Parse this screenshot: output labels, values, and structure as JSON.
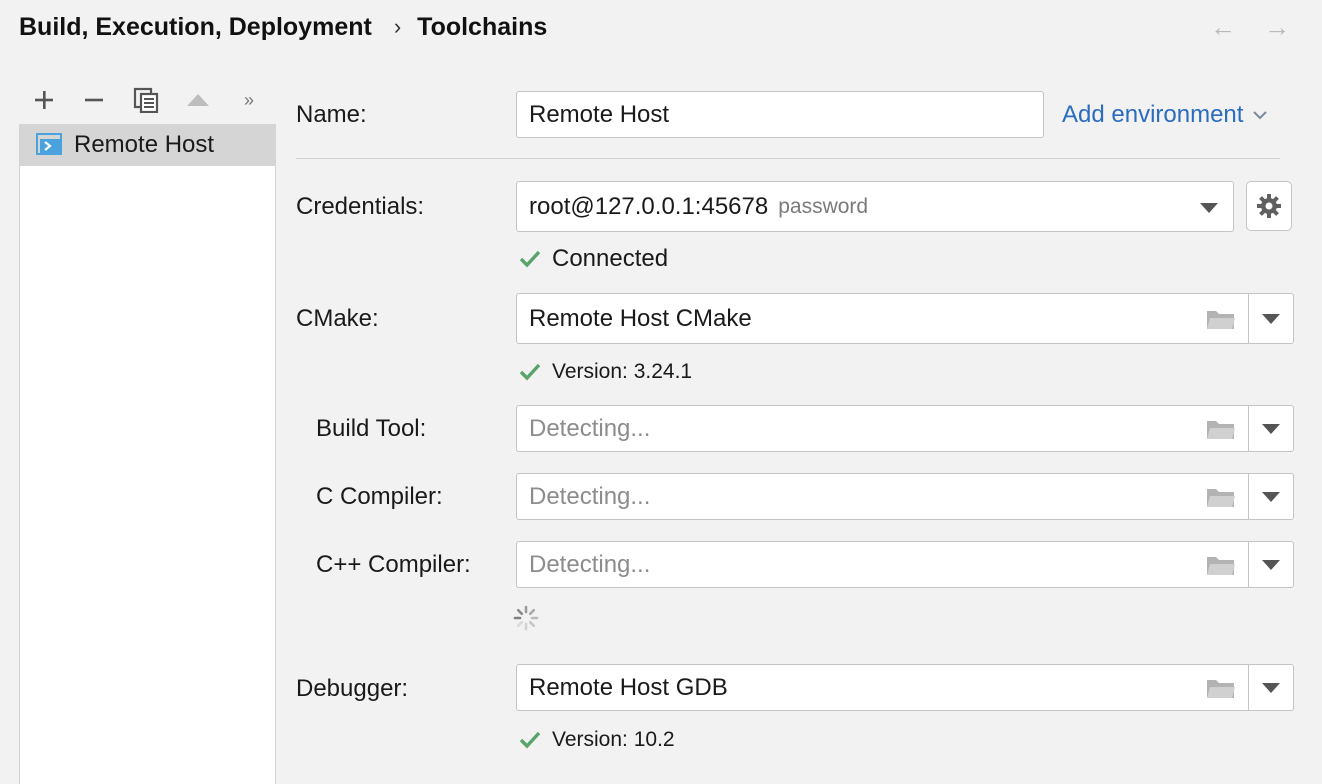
{
  "header": {
    "breadcrumb_parent": "Build, Execution, Deployment",
    "breadcrumb_separator": "›",
    "breadcrumb_current": "Toolchains",
    "back_arrow": "←",
    "forward_arrow": "→"
  },
  "toolbar": {
    "add_icon": "plus-icon",
    "remove_icon": "minus-icon",
    "copy_icon": "copy-icon",
    "move_up_icon": "triangle-up-icon",
    "more_label": "»"
  },
  "toolchains": {
    "items": [
      {
        "label": "Remote Host",
        "icon": "remote-host-icon",
        "selected": true
      }
    ]
  },
  "form": {
    "name_label": "Name:",
    "name_value": "Remote Host",
    "add_environment_label": "Add environment",
    "credentials_label": "Credentials:",
    "credentials_value": "root@127.0.0.1:45678",
    "credentials_hint": "password",
    "credentials_status": "Connected",
    "cmake_label": "CMake:",
    "cmake_value": "Remote Host CMake",
    "cmake_status": "Version: 3.24.1",
    "build_tool_label": "Build Tool:",
    "build_tool_placeholder": "Detecting...",
    "c_compiler_label": "C Compiler:",
    "c_compiler_placeholder": "Detecting...",
    "cpp_compiler_label": "C++ Compiler:",
    "cpp_compiler_placeholder": "Detecting...",
    "debugger_label": "Debugger:",
    "debugger_value": "Remote Host GDB",
    "debugger_status": "Version: 10.2"
  },
  "colors": {
    "background": "#f2f2f2",
    "link": "#2a6cc0",
    "success": "#5aa36a",
    "selection": "#d5d5d5",
    "icon_blue": "#4aa3df"
  }
}
